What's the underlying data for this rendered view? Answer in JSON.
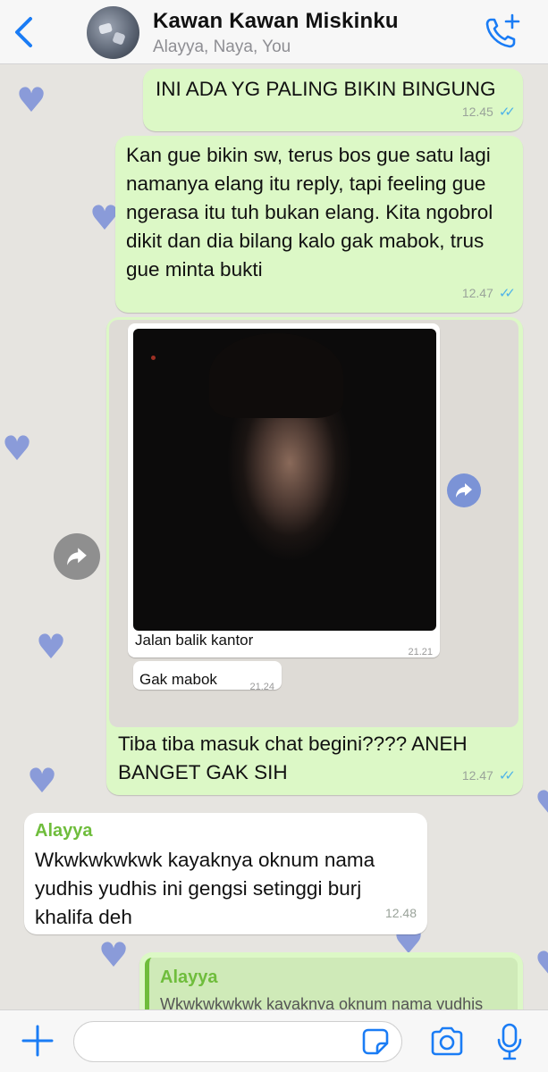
{
  "header": {
    "title": "Kawan Kawan Miskinku",
    "subtitle": "Alayya, Naya, You"
  },
  "messages": {
    "m1": {
      "text": "INI ADA YG PALING BIKIN BINGUNG",
      "time": "12.45"
    },
    "m2": {
      "text": "Kan gue bikin sw, terus bos gue satu lagi namanya elang itu reply, tapi feeling gue ngerasa itu tuh bukan elang. Kita ngobrol dikit dan dia bilang kalo gak mabok, trus gue minta bukti",
      "time": "12.47"
    },
    "m3": {
      "photo_caption": "Jalan balik kantor",
      "photo_time": "21.21",
      "inner_text": "Gak mabok",
      "inner_time": "21.24",
      "text": "Tiba tiba masuk chat begini???? ANEH BANGET GAK SIH",
      "time": "12.47"
    },
    "m4": {
      "sender": "Alayya",
      "text": "Wkwkwkwkwk kayaknya oknum nama yudhis yudhis ini gengsi setinggi burj khalifa deh",
      "time": "12.48"
    },
    "m5": {
      "quote_sender": "Alayya",
      "quote_text": "Wkwkwkwkwk kayaknya oknum nama yudhis"
    }
  },
  "colors": {
    "outgoing_bubble": "#dcf8c6",
    "incoming_bubble": "#ffffff",
    "accent_blue": "#1a7cf5",
    "sender_green": "#6fbd3c",
    "read_ticks": "#4fb3e8"
  },
  "icons": {
    "back": "chevron-left-icon",
    "call": "phone-plus-icon",
    "forward": "forward-arrow-icon",
    "plus": "plus-icon",
    "sticker": "sticker-icon",
    "camera": "camera-icon",
    "mic": "microphone-icon"
  }
}
